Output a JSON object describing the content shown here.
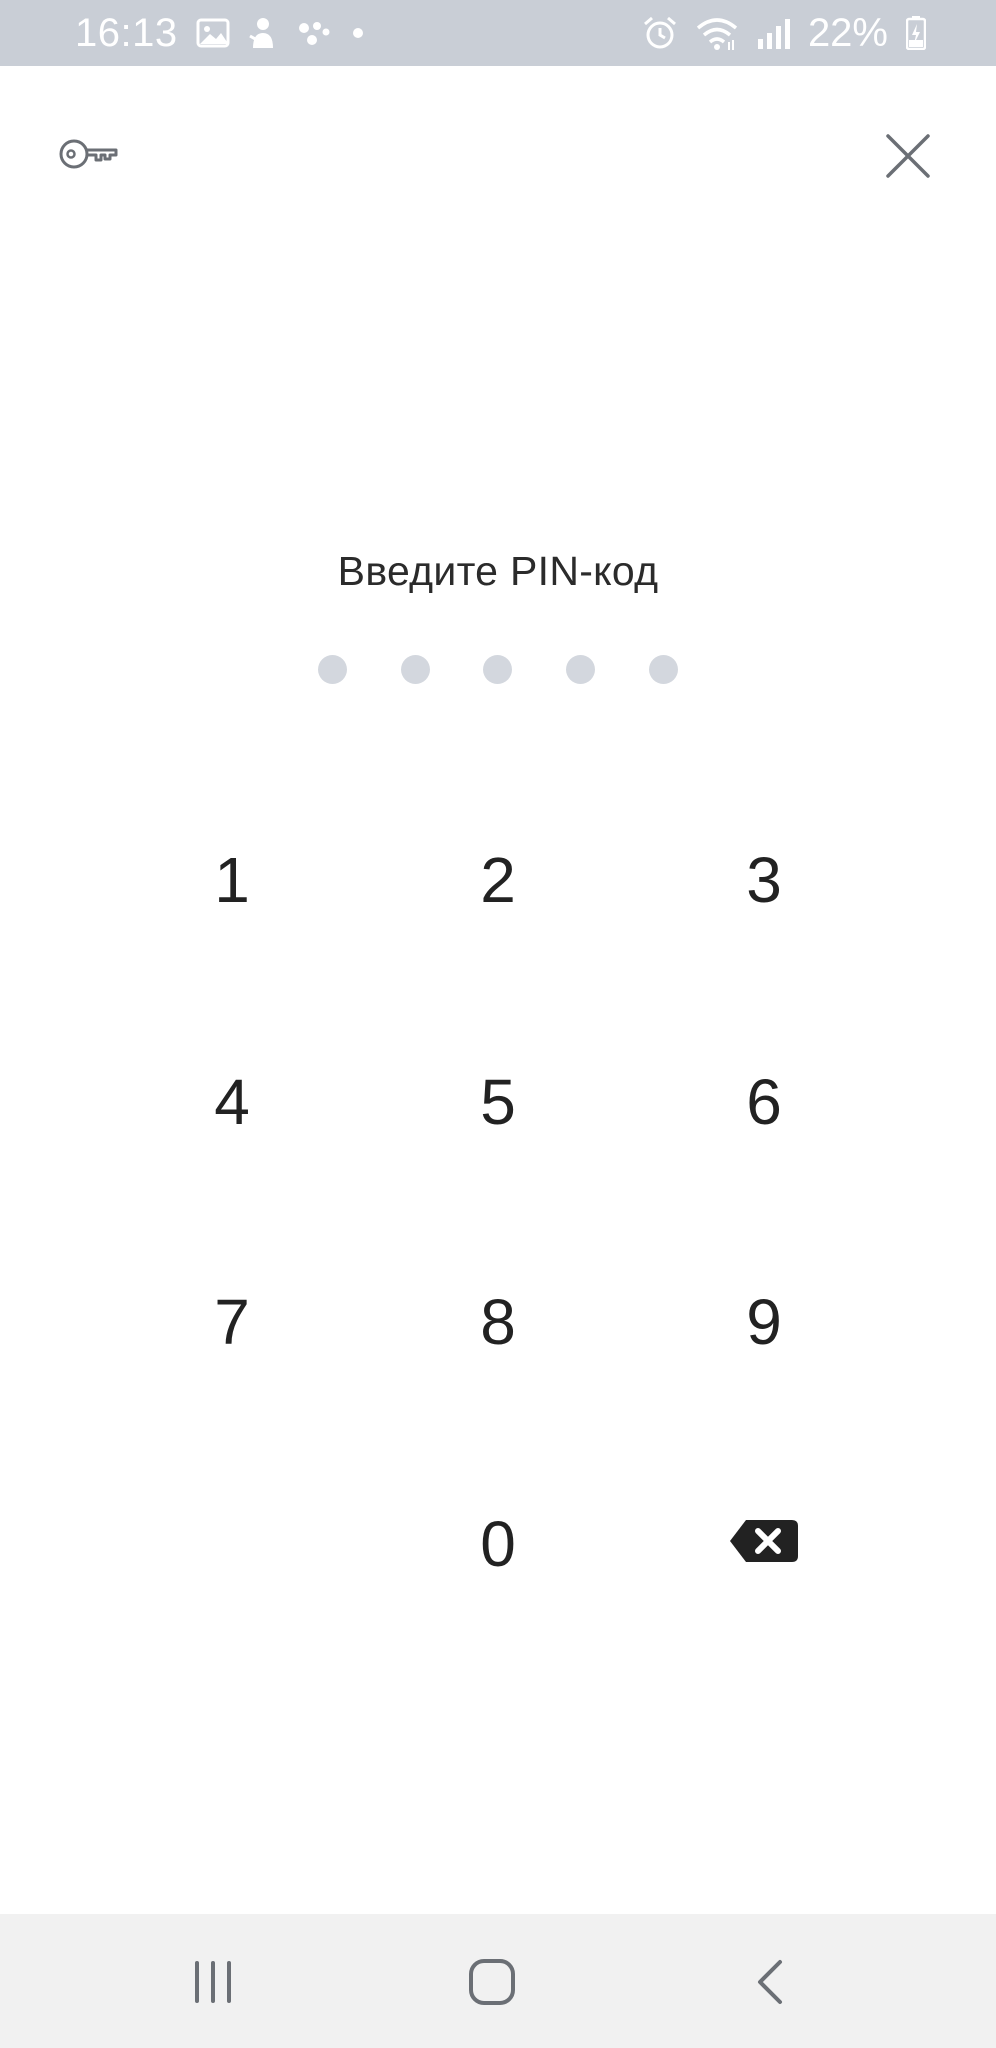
{
  "status_bar": {
    "time": "16:13",
    "battery_percent": "22%",
    "left_icons": [
      "image-icon",
      "app-notification-icon",
      "assistant-icon",
      "more-dot-icon"
    ],
    "right_icons": [
      "alarm-icon",
      "wifi-icon",
      "signal-icon",
      "battery-charging-icon"
    ]
  },
  "header": {
    "left_icon": "key-icon",
    "right_icon": "close-icon"
  },
  "pin": {
    "prompt": "Введите PIN-код",
    "length": 5,
    "entered": 0
  },
  "keypad": {
    "keys": [
      "1",
      "2",
      "3",
      "4",
      "5",
      "6",
      "7",
      "8",
      "9",
      "0"
    ],
    "delete_icon": "backspace-icon"
  },
  "nav_bar": {
    "buttons": [
      "recent-apps-icon",
      "home-icon",
      "back-icon"
    ]
  },
  "colors": {
    "status_bar_bg": "#c9ced6",
    "dot_empty": "#d3d7de",
    "text": "#222222",
    "icon": "#6b6f75",
    "nav_bg": "#f1f1f1"
  }
}
